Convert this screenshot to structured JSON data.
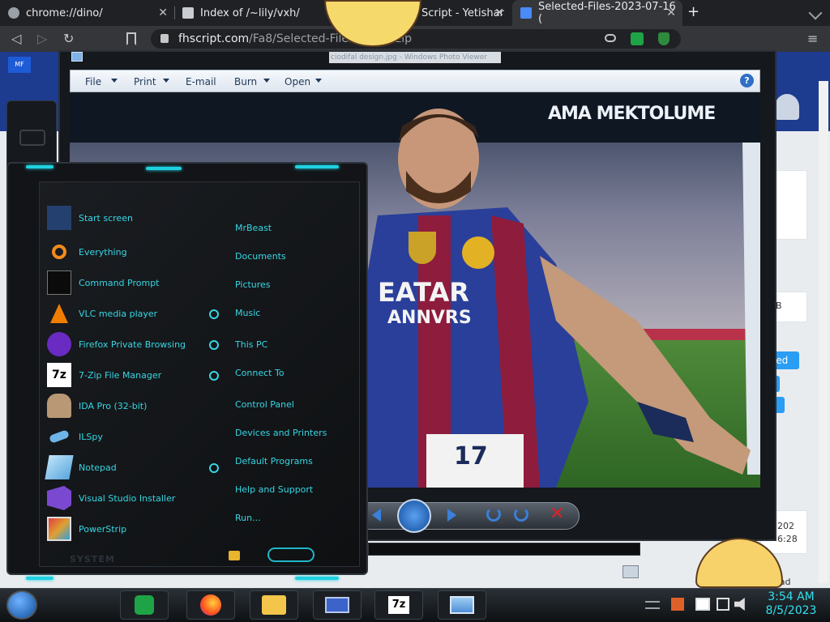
{
  "tabs": [
    {
      "title": "chrome://dino/",
      "active": false
    },
    {
      "title": "Index of /~lily/vxh/",
      "active": false
    },
    {
      "title": "Script - Yetishar",
      "active": false
    },
    {
      "title": "Selected-Files-2023-07-16 (",
      "active": true
    }
  ],
  "new_tab_symbol": "+",
  "close_symbol": "✕",
  "address_bar": {
    "host": "fhscript.com",
    "path": "/Fa8/Selected-Files-2023",
    "suffix": ").zip"
  },
  "viewer": {
    "title": "ciodifal design.jpg - Windows Photo Viewer",
    "menu": [
      "File",
      "Print",
      "E-mail",
      "Burn",
      "Open"
    ],
    "help_symbol": "?",
    "banner_text": "AMA MEKTOLUME",
    "jersey_text_1": "EATAR",
    "jersey_text_2": "ANNVRS",
    "jersey_number": "17"
  },
  "page_fragments": {
    "size_suffix": "B",
    "selected_btn": "cted",
    "date_1": "202",
    "date_2": "6:28",
    "download": "load"
  },
  "start_menu": {
    "programs": [
      {
        "label": "Start screen",
        "icon": "start-screen-icon",
        "color": "#3a6ee8"
      },
      {
        "label": "Everything",
        "icon": "magnifier-icon",
        "color": "#f28b1e"
      },
      {
        "label": "Command Prompt",
        "icon": "command-prompt-icon",
        "color": "#111111"
      },
      {
        "label": "VLC media player",
        "icon": "vlc-cone-icon",
        "color": "#f07d00"
      },
      {
        "label": "Firefox Private Browsing",
        "icon": "firefox-private-icon",
        "color": "#7a2fcf"
      },
      {
        "label": "7-Zip File Manager",
        "icon": "7zip-icon",
        "color": "#ffffff"
      },
      {
        "label": "IDA Pro (32-bit)",
        "icon": "ida-pro-icon",
        "color": "#c9a77d"
      },
      {
        "label": "ILSpy",
        "icon": "ilspy-icon",
        "color": "#6fb4e8"
      },
      {
        "label": "Notepad",
        "icon": "notepad-icon",
        "color": "#86c7f2"
      },
      {
        "label": "Visual Studio Installer",
        "icon": "visual-studio-icon",
        "color": "#8a55d8"
      },
      {
        "label": "PowerStrip",
        "icon": "powerstrip-icon",
        "color": "#e0a030"
      }
    ],
    "places": [
      "MrBeast",
      "Documents",
      "Pictures",
      "Music",
      "This PC",
      "Connect To",
      "Control Panel",
      "Devices and Printers",
      "Default Programs",
      "Help and Support",
      "Run..."
    ],
    "footer_label": "SYSTEM",
    "accent": "#36d6e3"
  },
  "seven_zip_label": "7z",
  "clock": {
    "time": "3:54 AM",
    "date": "8/5/2023"
  },
  "badge_label": "MF"
}
